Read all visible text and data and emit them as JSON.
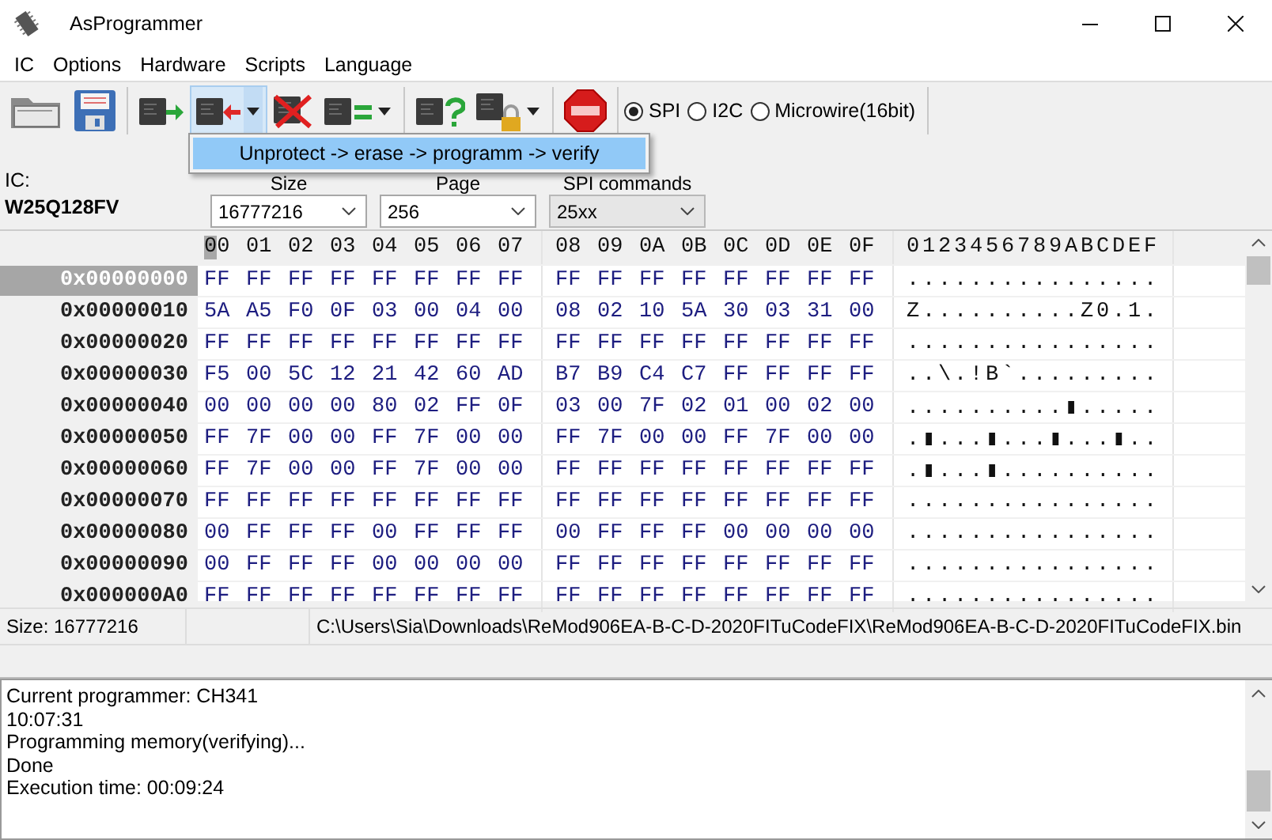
{
  "window": {
    "title": "AsProgrammer"
  },
  "menu": [
    {
      "label": "IC"
    },
    {
      "label": "Options"
    },
    {
      "label": "Hardware"
    },
    {
      "label": "Scripts"
    },
    {
      "label": "Language"
    }
  ],
  "toolbar": [
    {
      "kind": "open",
      "dropdown": false,
      "pressed": false
    },
    {
      "kind": "save",
      "dropdown": false,
      "pressed": false
    },
    {
      "kind": "separator"
    },
    {
      "kind": "read",
      "dropdown": false,
      "pressed": false
    },
    {
      "kind": "write",
      "dropdown": true,
      "pressed": true
    },
    {
      "kind": "erase",
      "dropdown": false,
      "pressed": false
    },
    {
      "kind": "verify",
      "dropdown": true,
      "pressed": false
    },
    {
      "kind": "separator"
    },
    {
      "kind": "detect",
      "dropdown": false,
      "pressed": false
    },
    {
      "kind": "protect",
      "dropdown": true,
      "pressed": false
    },
    {
      "kind": "separator"
    },
    {
      "kind": "stop",
      "dropdown": false,
      "pressed": false
    },
    {
      "kind": "separator"
    }
  ],
  "protocols": [
    {
      "label": "SPI",
      "selected": true
    },
    {
      "label": "I2C",
      "selected": false
    },
    {
      "label": "Microwire(16bit)",
      "selected": false
    }
  ],
  "dropdown_menu": {
    "items": [
      {
        "label": "Unprotect -> erase -> programm -> verify",
        "selected": true
      }
    ]
  },
  "ic": {
    "label": "IC:",
    "name": "W25Q128FV"
  },
  "settings": [
    {
      "label": "Size",
      "value": "16777216",
      "editable": true
    },
    {
      "label": "Page",
      "value": "256",
      "editable": true
    },
    {
      "label": "SPI commands",
      "value": "25xx",
      "editable": false
    }
  ],
  "hex": {
    "columns": [
      {
        "label": "00",
        "selected": true
      },
      {
        "label": "01",
        "selected": false
      },
      {
        "label": "02",
        "selected": false
      },
      {
        "label": "03",
        "selected": false
      },
      {
        "label": "04",
        "selected": false
      },
      {
        "label": "05",
        "selected": false
      },
      {
        "label": "06",
        "selected": false
      },
      {
        "label": "07",
        "selected": false
      },
      {
        "label": "08",
        "selected": false
      },
      {
        "label": "09",
        "selected": false
      },
      {
        "label": "0A",
        "selected": false
      },
      {
        "label": "0B",
        "selected": false
      },
      {
        "label": "0C",
        "selected": false
      },
      {
        "label": "0D",
        "selected": false
      },
      {
        "label": "0E",
        "selected": false
      },
      {
        "label": "0F",
        "selected": false
      }
    ],
    "ascii_header": "0123456789ABCDEF",
    "rows": [
      {
        "address": "0x00000000",
        "selected": true,
        "bytes": [
          "FF",
          "FF",
          "FF",
          "FF",
          "FF",
          "FF",
          "FF",
          "FF",
          "FF",
          "FF",
          "FF",
          "FF",
          "FF",
          "FF",
          "FF",
          "FF"
        ],
        "ascii": "................"
      },
      {
        "address": "0x00000010",
        "selected": false,
        "bytes": [
          "5A",
          "A5",
          "F0",
          "0F",
          "03",
          "00",
          "04",
          "00",
          "08",
          "02",
          "10",
          "5A",
          "30",
          "03",
          "31",
          "00"
        ],
        "ascii": "Z..........Z0.1."
      },
      {
        "address": "0x00000020",
        "selected": false,
        "bytes": [
          "FF",
          "FF",
          "FF",
          "FF",
          "FF",
          "FF",
          "FF",
          "FF",
          "FF",
          "FF",
          "FF",
          "FF",
          "FF",
          "FF",
          "FF",
          "FF"
        ],
        "ascii": "................"
      },
      {
        "address": "0x00000030",
        "selected": false,
        "bytes": [
          "F5",
          "00",
          "5C",
          "12",
          "21",
          "42",
          "60",
          "AD",
          "B7",
          "B9",
          "C4",
          "C7",
          "FF",
          "FF",
          "FF",
          "FF"
        ],
        "ascii": "..\\.!B`........."
      },
      {
        "address": "0x00000040",
        "selected": false,
        "bytes": [
          "00",
          "00",
          "00",
          "00",
          "80",
          "02",
          "FF",
          "0F",
          "03",
          "00",
          "7F",
          "02",
          "01",
          "00",
          "02",
          "00"
        ],
        "ascii": "..........▮....."
      },
      {
        "address": "0x00000050",
        "selected": false,
        "bytes": [
          "FF",
          "7F",
          "00",
          "00",
          "FF",
          "7F",
          "00",
          "00",
          "FF",
          "7F",
          "00",
          "00",
          "FF",
          "7F",
          "00",
          "00"
        ],
        "ascii": ".▮...▮...▮...▮.."
      },
      {
        "address": "0x00000060",
        "selected": false,
        "bytes": [
          "FF",
          "7F",
          "00",
          "00",
          "FF",
          "7F",
          "00",
          "00",
          "FF",
          "FF",
          "FF",
          "FF",
          "FF",
          "FF",
          "FF",
          "FF"
        ],
        "ascii": ".▮...▮.........."
      },
      {
        "address": "0x00000070",
        "selected": false,
        "bytes": [
          "FF",
          "FF",
          "FF",
          "FF",
          "FF",
          "FF",
          "FF",
          "FF",
          "FF",
          "FF",
          "FF",
          "FF",
          "FF",
          "FF",
          "FF",
          "FF"
        ],
        "ascii": "................"
      },
      {
        "address": "0x00000080",
        "selected": false,
        "bytes": [
          "00",
          "FF",
          "FF",
          "FF",
          "00",
          "FF",
          "FF",
          "FF",
          "00",
          "FF",
          "FF",
          "FF",
          "00",
          "00",
          "00",
          "00"
        ],
        "ascii": "................"
      },
      {
        "address": "0x00000090",
        "selected": false,
        "bytes": [
          "00",
          "FF",
          "FF",
          "FF",
          "00",
          "00",
          "00",
          "00",
          "FF",
          "FF",
          "FF",
          "FF",
          "FF",
          "FF",
          "FF",
          "FF"
        ],
        "ascii": "................"
      },
      {
        "address": "0x000000A0",
        "selected": false,
        "bytes": [
          "FF",
          "FF",
          "FF",
          "FF",
          "FF",
          "FF",
          "FF",
          "FF",
          "FF",
          "FF",
          "FF",
          "FF",
          "FF",
          "FF",
          "FF",
          "FF"
        ],
        "ascii": "................"
      }
    ]
  },
  "status_bar": [
    {
      "text": "Size: 16777216"
    },
    {
      "kind": "empty"
    },
    {
      "text": "C:\\Users\\Sia\\Downloads\\ReMod906EA-B-C-D-2020FITuCodeFIX\\ReMod906EA-B-C-D-2020FITuCodeFIX.bin"
    }
  ],
  "log": [
    "Current programmer: CH341",
    "10:07:31",
    "Programming memory(verifying)...",
    "Done",
    "Execution time: 00:09:24"
  ]
}
